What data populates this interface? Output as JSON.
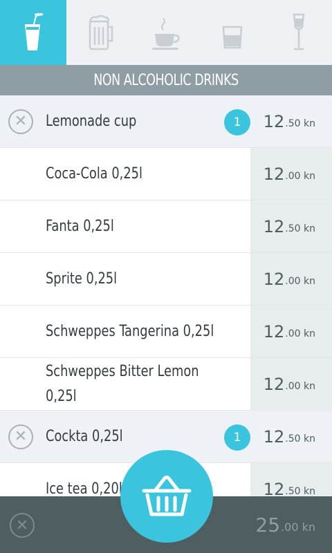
{
  "tabs": [
    {
      "name": "soft-drink",
      "icon": "soft-drink-icon",
      "active": true
    },
    {
      "name": "beer",
      "icon": "beer-mug-icon",
      "active": false
    },
    {
      "name": "coffee",
      "icon": "coffee-cup-icon",
      "active": false
    },
    {
      "name": "spirits",
      "icon": "shot-glass-icon",
      "active": false
    },
    {
      "name": "wine",
      "icon": "wine-glass-icon",
      "active": false
    }
  ],
  "section": {
    "title": "NON ALCOHOLIC DRINKS"
  },
  "items": [
    {
      "name": "Lemonade cup",
      "price_main": "12",
      "price_cents": ".50 kn",
      "qty": "1",
      "selected": true
    },
    {
      "name": "Coca-Cola 0,25l",
      "price_main": "12",
      "price_cents": ".00 kn",
      "qty": "",
      "selected": false
    },
    {
      "name": "Fanta 0,25l",
      "price_main": "12",
      "price_cents": ".50 kn",
      "qty": "",
      "selected": false
    },
    {
      "name": "Sprite 0,25l",
      "price_main": "12",
      "price_cents": ".00 kn",
      "qty": "",
      "selected": false
    },
    {
      "name": "Schweppes Tangerina 0,25l",
      "price_main": "12",
      "price_cents": ".00 kn",
      "qty": "",
      "selected": false
    },
    {
      "name": "Schweppes Bitter Lemon 0,25l",
      "price_main": "12",
      "price_cents": ".00 kn",
      "qty": "",
      "selected": false
    },
    {
      "name": "Cockta 0,25l",
      "price_main": "12",
      "price_cents": ".50 kn",
      "qty": "1",
      "selected": true
    },
    {
      "name": "Ice tea 0,20l",
      "price_main": "12",
      "price_cents": ".50 kn",
      "qty": "",
      "selected": false
    }
  ],
  "footer": {
    "total_main": "25",
    "total_cents": ".00 kn",
    "remove_icon": "close-icon"
  },
  "basket": {
    "icon": "basket-icon"
  },
  "colors": {
    "accent": "#3bc4dd",
    "header": "#8e9ea4",
    "footer": "#4f5f61",
    "price_column": "#e7eded"
  }
}
